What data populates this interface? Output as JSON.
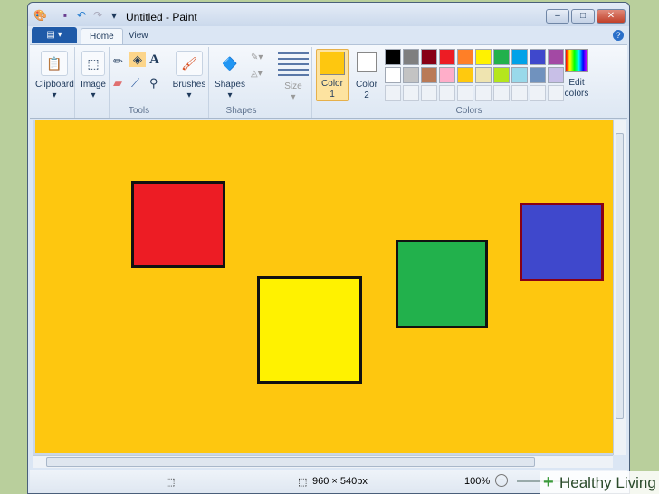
{
  "window": {
    "title": "Untitled - Paint"
  },
  "tabs": [
    {
      "label": "Home"
    },
    {
      "label": "View"
    }
  ],
  "ribbon": {
    "clipboard": "Clipboard",
    "image": "Image",
    "tools": "Tools",
    "brushes": "Brushes",
    "shapes": "Shapes",
    "shapes_group": "Shapes",
    "size": "Size",
    "color1": "Color\n1",
    "color1_a": "Color",
    "color1_b": "1",
    "color2_a": "Color",
    "color2_b": "2",
    "colors_group": "Colors",
    "edit_a": "Edit",
    "edit_b": "colors",
    "color1_value": "#fec70f",
    "color2_value": "#ffffff",
    "palette_row1": [
      "#000000",
      "#7f7f7f",
      "#880015",
      "#ed1c24",
      "#ff7f27",
      "#fff200",
      "#22b14c",
      "#00a2e8",
      "#3f48cc",
      "#a349a4"
    ],
    "palette_row2": [
      "#ffffff",
      "#c3c3c3",
      "#b97a57",
      "#ffaec9",
      "#ffc90e",
      "#efe4b0",
      "#b5e61d",
      "#99d9ea",
      "#7092be",
      "#c8bfe7"
    ]
  },
  "canvas": {
    "background": "#fec70f",
    "shapes": [
      {
        "fill": "#ed1c24",
        "border": "#111111"
      },
      {
        "fill": "#fff200",
        "border": "#111111"
      },
      {
        "fill": "#22b14c",
        "border": "#111111"
      },
      {
        "fill": "#3f48cc",
        "border": "#880015"
      }
    ]
  },
  "status": {
    "dimensions": "960 × 540px",
    "zoom": "100%"
  },
  "watermark": "Healthy Living"
}
